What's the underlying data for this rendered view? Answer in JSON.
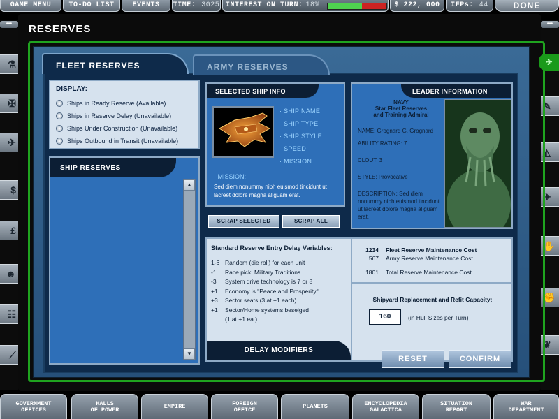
{
  "topbar": {
    "game_menu": "GAME MENU",
    "todo_list": "TO-DO LIST",
    "events": "EVENTS",
    "time_label": "TIME:",
    "time_value": "3025",
    "interest_label": "INTEREST ON TURN:",
    "interest_value": "18%",
    "interest_level": 0.58,
    "money": "$ 222, 000",
    "ifps_label": "IFPs:",
    "ifps_value": "44",
    "done": "DONE"
  },
  "page": {
    "title": "RESERVES"
  },
  "tabs": {
    "fleet": "FLEET RESERVES",
    "army": "ARMY RESERVES"
  },
  "display": {
    "title": "DISPLAY:",
    "options": [
      "Ships in Ready Reserve (Available)",
      "Ships in Reserve Delay (Unavailable)",
      "Ships Under Construction (Unavailable)",
      "Ships Outbound in Transit (Unavailable)"
    ]
  },
  "ship_reserves": {
    "title": "SHIP RESERVES"
  },
  "ship_info": {
    "title": "SELECTED SHIP INFO",
    "fields": [
      "· SHIP NAME",
      "· SHIP TYPE",
      "· SHIP STYLE",
      "· SPEED",
      "· MISSION"
    ],
    "mission_label": "· MISSION:",
    "mission_text": "Sed diem nonummy nibh euismod tincidunt ut lacreet dolore magna aliguam erat."
  },
  "buttons": {
    "scrap_selected": "SCRAP SELECTED",
    "scrap_all": "SCRAP ALL",
    "reset": "RESET",
    "confirm": "CONFIRM"
  },
  "leader": {
    "title": "LEADER INFORMATION",
    "rank": "NAVY",
    "role_line1": "Star Fleet Reserves",
    "role_line2": "and Training Admiral",
    "name": "NAME: Grognard G. Grognard",
    "ability": "ABILITY RATING: 7",
    "clout": "CLOUT: 3",
    "style": "STYLE: Provocative",
    "description": "DESCRIPTION: Sed diem nonummy nibh euismod tincidunt ut lacreet dolore magna aliguam erat."
  },
  "delay": {
    "title": "Standard Reserve Entry Delay Variables:",
    "rows": [
      {
        "val": "1-6",
        "text": "Random (die roll) for each unit"
      },
      {
        "val": "-1",
        "text": "Race pick:  Military Traditions"
      },
      {
        "val": "-3",
        "text": "System drive technology is 7 or 8"
      },
      {
        "val": "+1",
        "text": "Economy is \"Peace and Prosperity\""
      },
      {
        "val": "+3",
        "text": "Sector seats (3 at +1 each)"
      },
      {
        "val": "+1",
        "text": "Sector/Home systems beseiged"
      },
      {
        "val": "",
        "text": "(1 at +1 ea.)"
      }
    ],
    "footer": "DELAY MODIFIERS"
  },
  "costs": {
    "fleet_num": "1234",
    "fleet_label": "Fleet Reserve Maintenance Cost",
    "army_num": "567",
    "army_label": "Army Reserve Maintenance Cost",
    "total_num": "1801",
    "total_label": "Total Reserve Maintenance Cost",
    "shipyard_title": "Shipyard Replacement and Refit Capacity:",
    "hull_value": "160",
    "hull_label": "(in Hull Sizes per Turn)"
  },
  "bottomnav": [
    {
      "l1": "GOVERNMENT",
      "l2": "OFFICES"
    },
    {
      "l1": "HALLS",
      "l2": "OF POWER"
    },
    {
      "l1": "EMPIRE",
      "l2": ""
    },
    {
      "l1": "FOREIGN",
      "l2": "OFFICE"
    },
    {
      "l1": "PLANETS",
      "l2": ""
    },
    {
      "l1": "ENCYCLOPEDIA",
      "l2": "GALACTICA"
    },
    {
      "l1": "SITUATION",
      "l2": "REPORT"
    },
    {
      "l1": "WAR",
      "l2": "DEPARTMENT"
    }
  ],
  "side_icons": {
    "left": [
      "flask-icon",
      "shield-icon",
      "ship-icon",
      "dollar-icon",
      "pound-icon",
      "people-icon",
      "org-chart-icon",
      "graph-icon"
    ],
    "right": [
      "wrench-icon",
      "tank-icon",
      "plane-icon",
      "hand-icon",
      "fist-icon",
      "grenade-icon",
      "banner-icon"
    ],
    "left_glyphs": [
      "⚗",
      "✠",
      "✈",
      "$",
      "£",
      "☻",
      "☷",
      "⟋"
    ],
    "right_glyphs": [
      "✎",
      "◭",
      "✈",
      "✋",
      "✊",
      "❦",
      "⚑"
    ]
  },
  "green_tab": "✈"
}
